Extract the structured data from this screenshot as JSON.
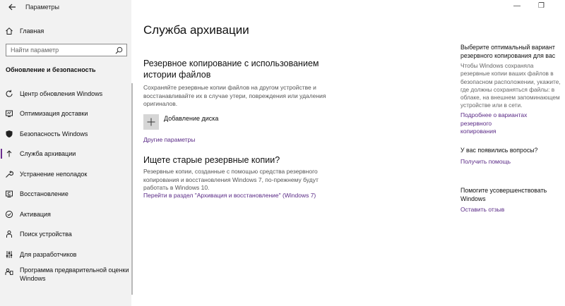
{
  "window": {
    "title": "Параметры",
    "controls": [
      "—",
      "❐"
    ]
  },
  "sidebar": {
    "home_label": "Главная",
    "search_placeholder": "Найти параметр",
    "section_title": "Обновление и безопасность",
    "items": [
      {
        "label": "Центр обновления Windows",
        "icon": "sync-icon",
        "active": false
      },
      {
        "label": "Оптимизация доставки",
        "icon": "delivery-icon",
        "active": false
      },
      {
        "label": "Безопасность Windows",
        "icon": "shield-icon",
        "active": false
      },
      {
        "label": "Служба архивации",
        "icon": "backup-arrow-icon",
        "active": true
      },
      {
        "label": "Устранение неполадок",
        "icon": "wrench-icon",
        "active": false
      },
      {
        "label": "Восстановление",
        "icon": "recovery-icon",
        "active": false
      },
      {
        "label": "Активация",
        "icon": "check-circle-icon",
        "active": false
      },
      {
        "label": "Поиск устройства",
        "icon": "person-pin-icon",
        "active": false
      },
      {
        "label": "Для разработчиков",
        "icon": "sliders-icon",
        "active": false
      },
      {
        "label": "Программа предварительной оценки Windows",
        "line1": "Программа предварительной оценки",
        "line2": "Windows",
        "icon": "insider-icon",
        "active": false
      }
    ]
  },
  "main": {
    "title": "Служба архивации",
    "history": {
      "heading_line1": "Резервное копирование с использованием",
      "heading_line2": "истории файлов",
      "desc_line1": "Сохраняйте резервные копии файлов на другом устройстве и",
      "desc_line2": "восстанавливайте их в случае утери, повреждения или удаления",
      "desc_line3": "оригиналов.",
      "add_drive_label": "Добавление диска",
      "more_options_link": "Другие параметры"
    },
    "old_backups": {
      "heading": "Ищете старые резервные копии?",
      "desc_line1": "Резервные копии, созданные с помощью средства резервного",
      "desc_line2": "копирования и восстановления Windows 7, по-прежнему будут",
      "desc_line3": "работать в Windows 10.",
      "link": "Перейти в раздел \"Архивация и восстановление\" (Windows 7)"
    }
  },
  "right_panel": {
    "choose": {
      "title_line1": "Выберите оптимальный вариант",
      "title_line2": "резервного копирования для вас",
      "text_lines": [
        "Чтобы Windows сохраняла",
        "резервные копии ваших файлов в",
        "безопасном расположении, укажите,",
        "где должны сохраняться файлы: в",
        "облаке, на внешнем запоминающем",
        "устройстве или в сети."
      ],
      "link_line1": "Подробнее о вариантах резервного",
      "link_line2": "копирования"
    },
    "questions": {
      "title": "У вас появились вопросы?",
      "link": "Получить помощь"
    },
    "improve": {
      "title_line1": "Помогите усовершенствовать",
      "title_line2": "Windows",
      "link": "Оставить отзыв"
    }
  },
  "colors": {
    "accent": "#5a2a86",
    "sidebar_bg": "#f2f2f2"
  }
}
